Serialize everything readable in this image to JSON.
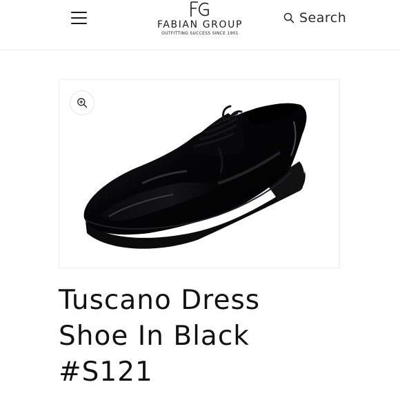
{
  "header": {
    "menu_icon": "hamburger-menu-icon",
    "logo": {
      "monogram": "FG",
      "name": "FABIAN GROUP",
      "tagline": "OUTFITTING SUCCESS SINCE 1901"
    },
    "search": {
      "icon": "search-icon",
      "label": "Search"
    }
  },
  "product": {
    "image": {
      "subject": "black patent leather lace-up dress shoe",
      "zoom_icon": "zoom-in-icon"
    },
    "title_lines": [
      "Tuscano Dress",
      "Shoe In Black",
      "#S121"
    ]
  },
  "colors": {
    "text": "#121212",
    "border": "#ececec",
    "background": "#ffffff"
  }
}
